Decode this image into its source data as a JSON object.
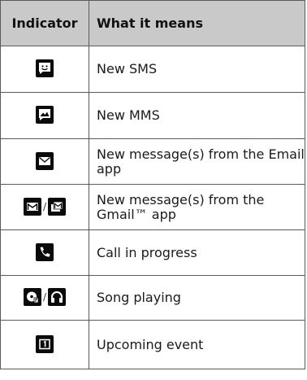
{
  "table": {
    "header": {
      "indicator": "Indicator",
      "meaning": "What it means"
    },
    "rows": [
      {
        "icons": [
          "sms-icon"
        ],
        "separator": "",
        "meaning": "New SMS"
      },
      {
        "icons": [
          "mms-icon"
        ],
        "separator": "",
        "meaning": "New MMS"
      },
      {
        "icons": [
          "email-icon"
        ],
        "separator": "",
        "meaning": "New message(s) from the Email app"
      },
      {
        "icons": [
          "gmail-icon",
          "gmail-stack-icon"
        ],
        "separator": "/",
        "meaning": "New message(s) from the Gmail™ app"
      },
      {
        "icons": [
          "phone-icon"
        ],
        "separator": "",
        "meaning": "Call in progress"
      },
      {
        "icons": [
          "music-disc-icon",
          "headphones-icon"
        ],
        "separator": "/",
        "meaning": "Song playing"
      },
      {
        "icons": [
          "calendar-event-icon"
        ],
        "separator": "",
        "meaning": "Upcoming event"
      }
    ]
  }
}
